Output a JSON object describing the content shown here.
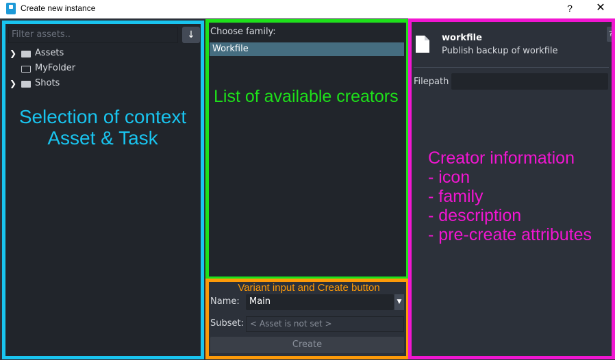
{
  "window": {
    "title": "Create new instance",
    "help_label": "?",
    "close_label": "✕"
  },
  "assets_panel": {
    "filter_placeholder": "Filter assets..",
    "refresh_icon": "↓",
    "tree": [
      {
        "label": "Assets",
        "expandable": true,
        "icon": "folder-filled"
      },
      {
        "label": "MyFolder",
        "expandable": false,
        "icon": "folder-outline"
      },
      {
        "label": "Shots",
        "expandable": true,
        "icon": "folder-filled"
      }
    ],
    "expand_glyph": "❯"
  },
  "family_panel": {
    "choose_label": "Choose family:",
    "items": [
      "Workfile"
    ],
    "selected": "Workfile"
  },
  "variant_panel": {
    "name_label": "Name:",
    "name_value": "Main",
    "dropdown_glyph": "▼",
    "subset_label": "Subset:",
    "subset_value": "< Asset is not set >",
    "create_label": "Create"
  },
  "creator_info": {
    "name": "workfile",
    "description": "Publish backup of workfile",
    "help_label": "?",
    "filepath_label": "Filepath",
    "filepath_value": ""
  },
  "annotations": {
    "cyan": [
      "Selection of context",
      "Asset & Task"
    ],
    "green": "List of available creators",
    "orange": "Variant input and Create button",
    "magenta": [
      "Creator information",
      "- icon",
      "- family",
      "- description",
      "- pre-create attributes"
    ]
  },
  "colors": {
    "cyan": "#19c4ef",
    "green": "#1ee11a",
    "orange": "#fd9a09",
    "magenta": "#f116d1",
    "selection": "#456d80"
  }
}
